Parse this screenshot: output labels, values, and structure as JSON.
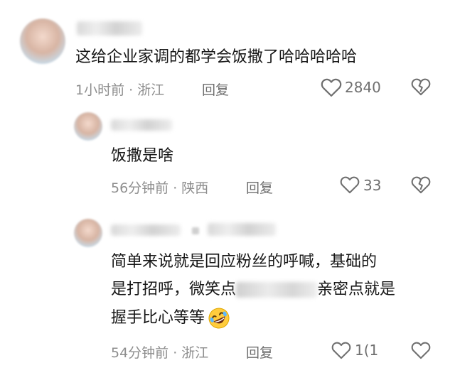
{
  "comments": [
    {
      "text": "这给企业家调的都学会饭撒了哈哈哈哈哈",
      "time": "1小时前",
      "location": "浙江",
      "reply_label": "回复",
      "like_count": "2840"
    },
    {
      "text": "饭撒是啥",
      "time": "56分钟前",
      "location": "陕西",
      "reply_label": "回复",
      "like_count": "33"
    },
    {
      "line1": "简单来说就是回应粉丝的呼喊，基础的",
      "line2_start": "是打招呼，微笑点",
      "line2_end": "亲密点就是",
      "line3": "握手比心等等",
      "time": "54分钟前",
      "location": "浙江",
      "reply_label": "回复",
      "like_count": "1(1"
    }
  ],
  "meta_separator": "·",
  "icons": {
    "like": "heart-outline-icon",
    "dislike": "broken-heart-icon",
    "emoji": "rolling-on-floor-laughing-emoji"
  },
  "colors": {
    "meta": "#8e8e8e",
    "text": "#161616",
    "icon": "#6f6f6f"
  }
}
